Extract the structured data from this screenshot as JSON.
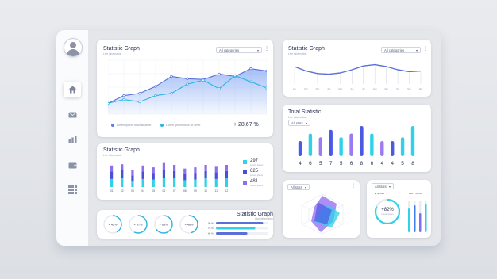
{
  "nav": {
    "items": [
      {
        "icon": "home-icon",
        "active": true
      },
      {
        "icon": "mail-icon",
        "active": false
      },
      {
        "icon": "bar-chart-icon",
        "active": false
      },
      {
        "icon": "wallet-icon",
        "active": false
      },
      {
        "icon": "grid-icon",
        "active": false
      }
    ]
  },
  "colors": {
    "accent": "#3f7ef0",
    "purple": "#7c6ff2",
    "cyan": "#2fd2e8",
    "navy": "#4a4fd6",
    "text": "#2b3256"
  },
  "main_graph": {
    "title": "Statistic Graph",
    "subtitle": "Live information",
    "dropdown": "All categories",
    "legend": [
      "Lorem ipsum dolor sit amet",
      "Lorem ipsum dolor sit amet"
    ],
    "percent": "+ 28,67 %"
  },
  "top_right": {
    "title": "Statistic Graph",
    "subtitle": "Live information",
    "dropdown": "All categories"
  },
  "bar_graph": {
    "title": "Statistic Graph",
    "subtitle": "Live information",
    "stats": [
      {
        "value": "297",
        "label": "Lorem ipsum"
      },
      {
        "value": "625",
        "label": "Lorem ipsum"
      },
      {
        "value": "481",
        "label": "Lorem ipsum"
      }
    ]
  },
  "total": {
    "title": "Total Statistic",
    "subtitle": "Live information",
    "dropdown": "All stats"
  },
  "progress_card": {
    "title": "Statistic Graph",
    "subtitle": "Live information",
    "rings": [
      {
        "label": "+ 42%",
        "value": 0.42
      },
      {
        "label": "+ 57%",
        "value": 0.57
      },
      {
        "label": "+ 65%",
        "value": 0.65
      },
      {
        "label": "+ 46%",
        "value": 0.46
      }
    ],
    "bars": [
      {
        "label": "90 %",
        "value": 0.9
      },
      {
        "label": "75 %",
        "value": 0.75
      },
      {
        "label": "60 %",
        "value": 0.6
      }
    ]
  },
  "radar_card": {
    "dropdown": "All stats"
  },
  "donut_card": {
    "dropdown": "All stats",
    "label_a": "Spread",
    "label_b": "Last 7 Month",
    "center": "+82%",
    "center_sub": "Lorem ipsum"
  },
  "chart_data": [
    {
      "type": "area",
      "series": [
        {
          "name": "Lorem ipsum dolor sit amet",
          "values": [
            14,
            24,
            27,
            36,
            49,
            46,
            45,
            52,
            49,
            59,
            56
          ]
        },
        {
          "name": "Lorem ipsum dolor sit amet",
          "values": [
            14,
            19,
            16,
            24,
            27,
            39,
            44,
            33,
            50,
            42,
            34
          ]
        }
      ],
      "ylim": [
        0,
        70
      ]
    },
    {
      "type": "line",
      "x": [
        "Jan",
        "Feb",
        "Mar",
        "Apr",
        "May",
        "Jun",
        "Jul",
        "Aug",
        "Sep",
        "Oct",
        "Nov",
        "Dec"
      ],
      "values": [
        25,
        18,
        14,
        13,
        15,
        20,
        26,
        28,
        25,
        20,
        17,
        18
      ],
      "ylim": [
        0,
        35
      ]
    },
    {
      "type": "bar",
      "categories": [
        "01",
        "02",
        "03",
        "04",
        "05",
        "06",
        "07",
        "08",
        "09",
        "10",
        "11",
        "12"
      ],
      "series": [
        {
          "name": "297",
          "values": [
            13,
            14,
            10,
            13,
            12,
            15,
            14,
            11,
            12,
            14,
            13,
            14
          ]
        },
        {
          "name": "625",
          "values": [
            12,
            13,
            9,
            12,
            11,
            13,
            12,
            10,
            11,
            12,
            11,
            12
          ]
        },
        {
          "name": "481",
          "values": [
            10,
            10,
            8,
            10,
            9,
            11,
            10,
            9,
            9,
            10,
            9,
            10
          ]
        }
      ],
      "ylim": [
        0,
        45
      ]
    },
    {
      "type": "bar",
      "categories": [
        "4",
        "6",
        "5",
        "7",
        "5",
        "6",
        "8",
        "6",
        "4",
        "4",
        "5",
        "8"
      ],
      "values": [
        4,
        6,
        5,
        7,
        5,
        6,
        8,
        6,
        4,
        4,
        5,
        8
      ],
      "ylim": [
        0,
        8
      ]
    }
  ]
}
